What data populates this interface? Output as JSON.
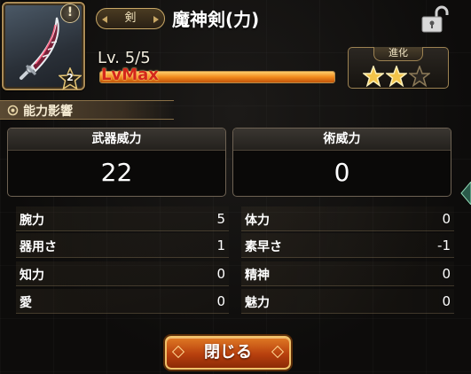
{
  "item": {
    "type_label": "剣",
    "name": "魔神剣(力)",
    "info_badge": "!",
    "rarity": "2",
    "level_text": "Lv. 5/5",
    "level_max_label": "LvMax",
    "level_progress": 1.0
  },
  "evolution": {
    "title": "進化",
    "stars_filled": 2,
    "stars_total": 3
  },
  "section": {
    "title": "能力影響"
  },
  "power": {
    "weapon": {
      "label": "武器威力",
      "value": "22"
    },
    "magic": {
      "label": "術威力",
      "value": "0"
    }
  },
  "stats": {
    "left": [
      {
        "name": "腕力",
        "value": "5"
      },
      {
        "name": "器用さ",
        "value": "1"
      },
      {
        "name": "知力",
        "value": "0"
      },
      {
        "name": "愛",
        "value": "0"
      }
    ],
    "right": [
      {
        "name": "体力",
        "value": "0"
      },
      {
        "name": "素早さ",
        "value": "-1"
      },
      {
        "name": "精神",
        "value": "0"
      },
      {
        "name": "魅力",
        "value": "0"
      }
    ]
  },
  "close_label": "閉じる",
  "icons": {
    "weapon": "sword-icon",
    "lock": "lock-icon",
    "info": "info-icon",
    "star": "star-icon",
    "gear": "gear-icon"
  },
  "colors": {
    "gold": "#c9a866",
    "level_fill": "#f28a1c",
    "max_text": "#d4271c",
    "button": "#b8400e"
  }
}
